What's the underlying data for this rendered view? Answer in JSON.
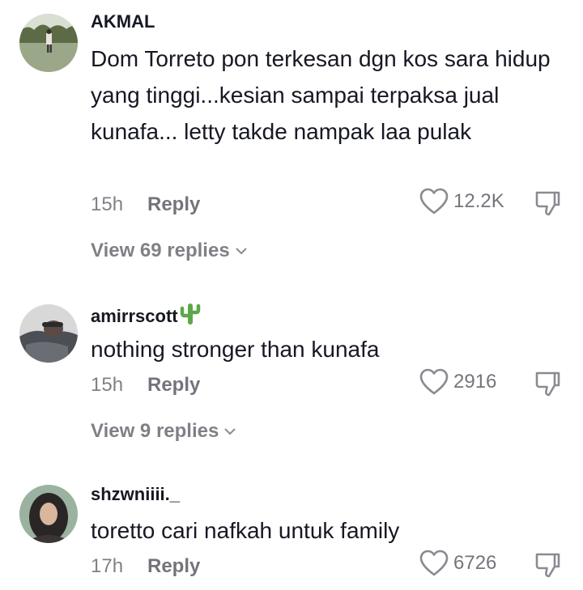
{
  "comments": [
    {
      "username": "AKMAL",
      "text": "Dom Torreto pon terkesan dgn kos sara hidup yang tinggi...kesian sampai terpaksa jual kunafa... letty takde nampak laa pulak",
      "time": "15h",
      "reply_label": "Reply",
      "likes": "12.2K",
      "view_replies": "View 69 replies"
    },
    {
      "username": "amirrscott",
      "username_emoji": "cactus-icon",
      "text": "nothing stronger than kunafa",
      "time": "15h",
      "reply_label": "Reply",
      "likes": "2916",
      "view_replies": "View 9 replies"
    },
    {
      "username": "shzwniiii._",
      "text": "toretto cari nafkah untuk family",
      "time": "17h",
      "reply_label": "Reply",
      "likes": "6726"
    }
  ],
  "icons": {
    "like": "heart-outline-icon",
    "dislike": "thumbs-down-icon",
    "expand": "chevron-down-icon"
  },
  "colors": {
    "text": "#161823",
    "muted": "#8a8b91",
    "background": "#ffffff"
  }
}
